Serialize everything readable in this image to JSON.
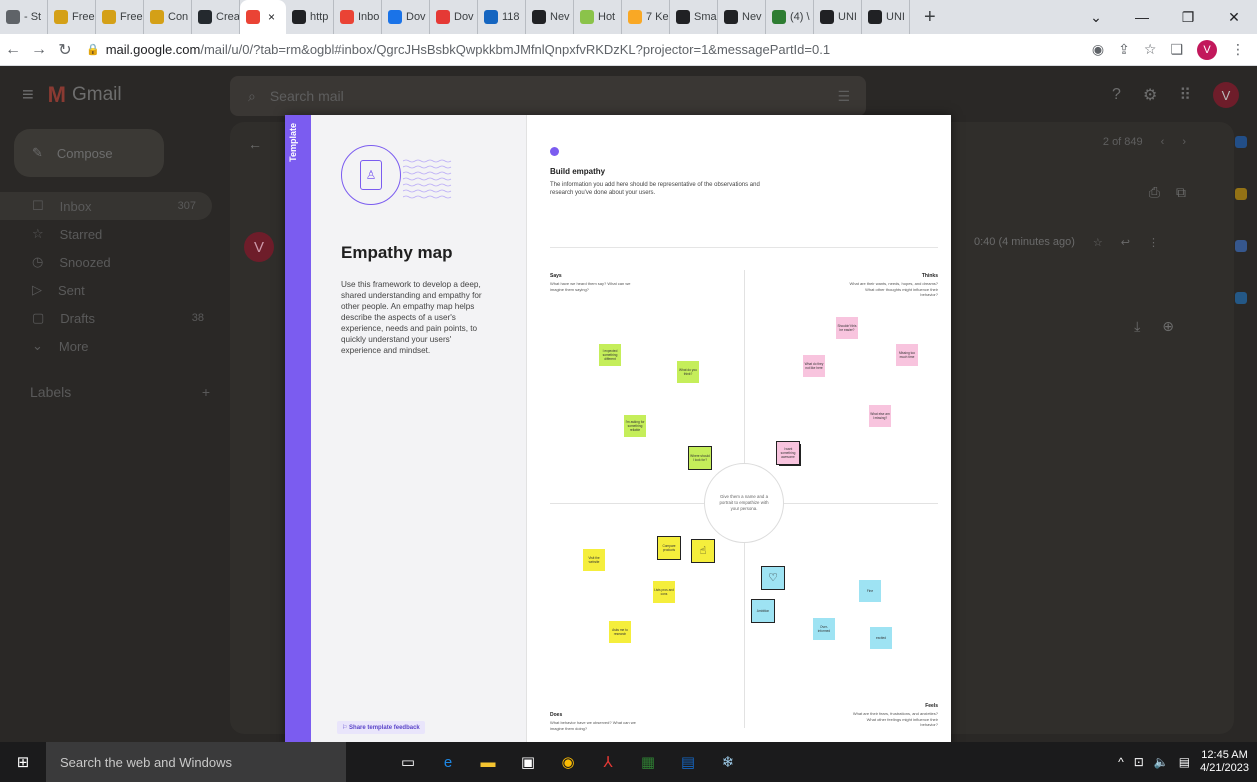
{
  "browser": {
    "tabs": [
      {
        "label": "- St",
        "color": "#5f6368",
        "active": false
      },
      {
        "label": "Free",
        "color": "#d4a017",
        "active": false
      },
      {
        "label": "Free",
        "color": "#d4a017",
        "active": false
      },
      {
        "label": "Con",
        "color": "#d4a017",
        "active": false
      },
      {
        "label": "Crea",
        "color": "#24292e",
        "active": false
      },
      {
        "label": "",
        "color": "#ea4335",
        "active": true
      },
      {
        "label": "http",
        "color": "#202124",
        "active": false
      },
      {
        "label": "Inbo",
        "color": "#ea4335",
        "active": false
      },
      {
        "label": "Dov",
        "color": "#1a73e8",
        "active": false
      },
      {
        "label": "Dov",
        "color": "#e53935",
        "active": false
      },
      {
        "label": "118",
        "color": "#1565c0",
        "active": false
      },
      {
        "label": "Nev",
        "color": "#202124",
        "active": false
      },
      {
        "label": "Hot",
        "color": "#8bc34a",
        "active": false
      },
      {
        "label": "7 Ke",
        "color": "#f9a825",
        "active": false
      },
      {
        "label": "Sma",
        "color": "#202124",
        "active": false
      },
      {
        "label": "Nev",
        "color": "#202124",
        "active": false
      },
      {
        "label": "(4) \\",
        "color": "#2e7d32",
        "active": false
      },
      {
        "label": "UNI",
        "color": "#202124",
        "active": false
      },
      {
        "label": "UNI",
        "color": "#202124",
        "active": false
      }
    ],
    "active_tab_close": "×",
    "new_tab": "+",
    "window_controls": [
      "⌄",
      "—",
      "❐",
      "✕"
    ],
    "url_host": "mail.google.com",
    "url_path": "/mail/u/0/?tab=rm&ogbl#inbox/QgrcJHsBsbkQwpkkbmJMfnlQnpxfvRKDzKL?projector=1&messagePartId=0.1",
    "profile_initial": "V"
  },
  "gmail": {
    "logo_text": "Gmail",
    "search_placeholder": "Search mail",
    "compose_label": "Compose",
    "nav": [
      {
        "icon": "☐",
        "label": "Inbox",
        "count": "307",
        "selected": true
      },
      {
        "icon": "☆",
        "label": "Starred",
        "count": "",
        "selected": false
      },
      {
        "icon": "◷",
        "label": "Snoozed",
        "count": "",
        "selected": false
      },
      {
        "icon": "▷",
        "label": "Sent",
        "count": "",
        "selected": false
      },
      {
        "icon": "▢",
        "label": "Drafts",
        "count": "38",
        "selected": false
      },
      {
        "icon": "⌄",
        "label": "More",
        "count": "",
        "selected": false
      }
    ],
    "labels_title": "Labels",
    "pager_text": "2 of 849",
    "avatar_initial": "V",
    "message_time": "0:40 (4 minutes ago)"
  },
  "preview": {
    "strip_label": "Template",
    "title": "Empathy map",
    "description": "Use this framework to develop a deep, shared understanding and empathy for other people. An empathy map helps describe the aspects of a user's experience, needs and pain points, to quickly understand your users' experience and mindset.",
    "feedback_label": "Share template feedback",
    "build_heading": "Build empathy",
    "build_sub": "The information you add here should be representative of the observations and research you've done about your users.",
    "center_text": "Give them a name and a portrait to empathize with your persona.",
    "says_title": "Says",
    "says_text": "What have we heard them say? What can we imagine them saying?",
    "thinks_title": "Thinks",
    "thinks_text": "What are their wants, needs, hopes, and dreams? What other thoughts might influence their behavior?",
    "does_title": "Does",
    "does_text": "What behavior have we observed? What can we imagine them doing?",
    "feels_title": "Feels",
    "feels_text": "What are their fears, frustrations, and anxieties? What other feelings might influence their behavior?",
    "notes": {
      "g1": "I expected something different",
      "g2": "What do you think?",
      "g3": "I'm asking for something reliable",
      "g4": "Where should I look for?",
      "p1": "Shouldn't this be easier?",
      "p2": "What do they not like here",
      "p3": "Missing too much time",
      "p4": "What else am I missing?",
      "p5": "I want something awesome",
      "y1": "Visit the website",
      "y2": "Compare products",
      "y3": "Lists pros and cons",
      "y4": "Asks me to research",
      "b1": "Ambition",
      "b2": "Fine",
      "b3": "Over-informed",
      "b4": "excited"
    }
  },
  "taskbar": {
    "search_placeholder": "Search the web and Windows",
    "time": "12:45 AM",
    "date": "4/21/2023"
  }
}
